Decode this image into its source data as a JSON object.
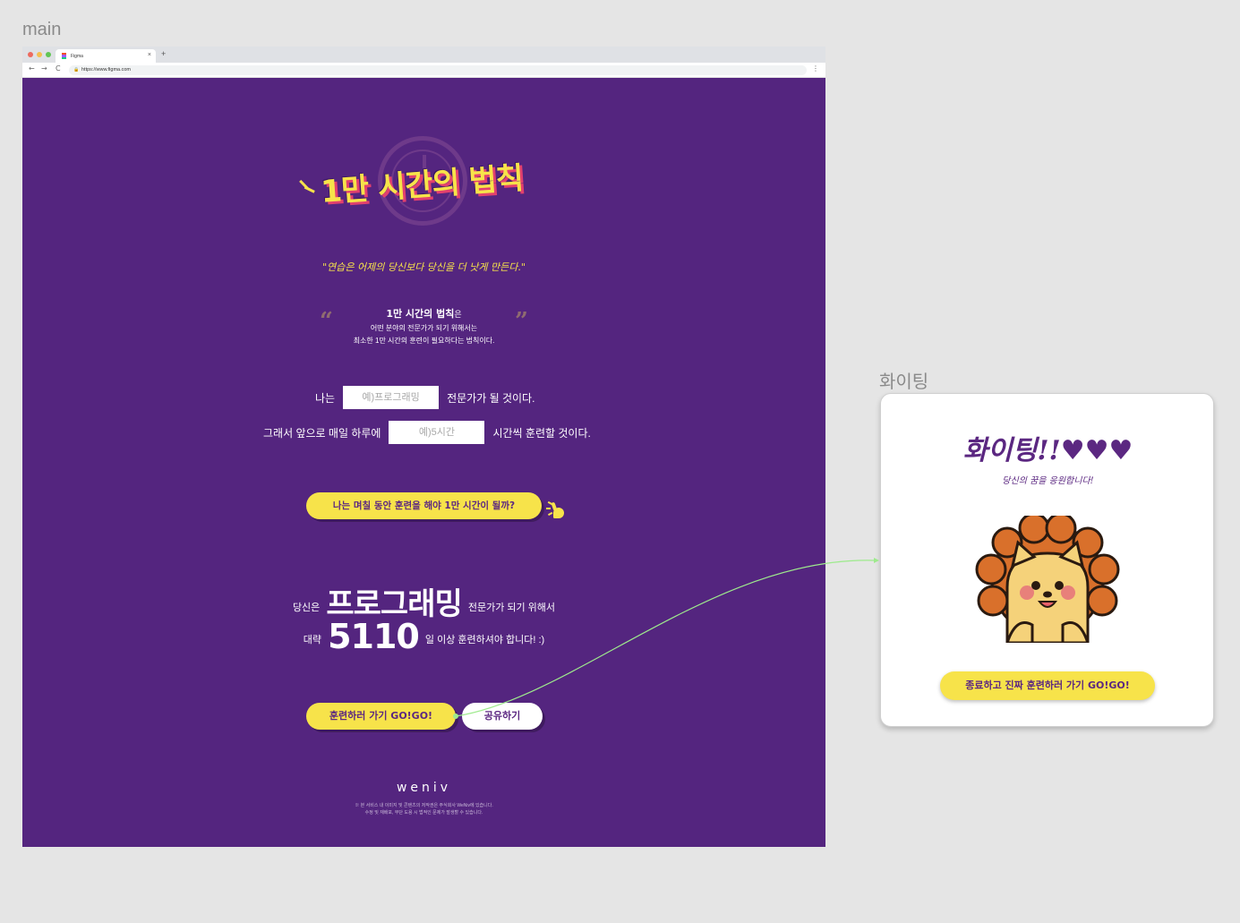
{
  "frames": {
    "main_label": "main",
    "popup_label": "화이팅"
  },
  "browser": {
    "tab_title": "Figma",
    "tab_close": "×",
    "new_tab": "+",
    "url": "https://www.figma.com",
    "nav": {
      "back": "←",
      "forward": "→",
      "reload": "C",
      "menu": "⋮"
    }
  },
  "main": {
    "title": "1만 시간의 법칙",
    "quote": "\"연습은 어제의 당신보다 당신을 더 낫게 만든다.\"",
    "description": {
      "bold": "1만 시간의 법칙",
      "bold_suffix": "은",
      "line2": "어떤 분야의 전문가가 되기 위해서는",
      "line3": "최소한 1만 시간의 훈련이 필요하다는 법칙이다.",
      "open_quote": "“",
      "close_quote": "”"
    },
    "form": {
      "row1_prefix": "나는",
      "field_placeholder": "예)프로그래밍",
      "row1_suffix": "전문가가 될 것이다.",
      "row2_prefix": "그래서 앞으로 매일 하루에",
      "time_placeholder": "예)5시간",
      "row2_suffix": "시간씩 훈련할 것이다."
    },
    "calc_button": "나는 며칠 동안 훈련을 해야 1만 시간이 될까?",
    "result": {
      "line1_prefix": "당신은",
      "field": "프로그래밍",
      "line1_suffix": "전문가가 되기 위해서",
      "line2_prefix": "대략",
      "days": "5110",
      "line2_suffix": "일 이상 훈련하셔야 합니다! :)"
    },
    "go_button": "훈련하러 가기 GO!GO!",
    "share_button": "공유하기",
    "footer": {
      "brand": "weniv",
      "note1": "※ 본 서비스 내 이미지 및 콘텐츠의 저작권은 주식회사 WeNiv에 있습니다.",
      "note2": "수정 및 재배포, 무단 도용 시 법적인 문제가 발생할 수 있습니다."
    }
  },
  "popup": {
    "title": "화이팅!!♥♥♥",
    "subtitle": "당신의 꿈을 응원합니다!",
    "end_button": "종료하고 진짜 훈련하러 가기 GO!GO!"
  },
  "colors": {
    "background": "#54257f",
    "accent": "#f7e34a",
    "purple_text": "#5b2781",
    "connector": "#9eea8d"
  }
}
